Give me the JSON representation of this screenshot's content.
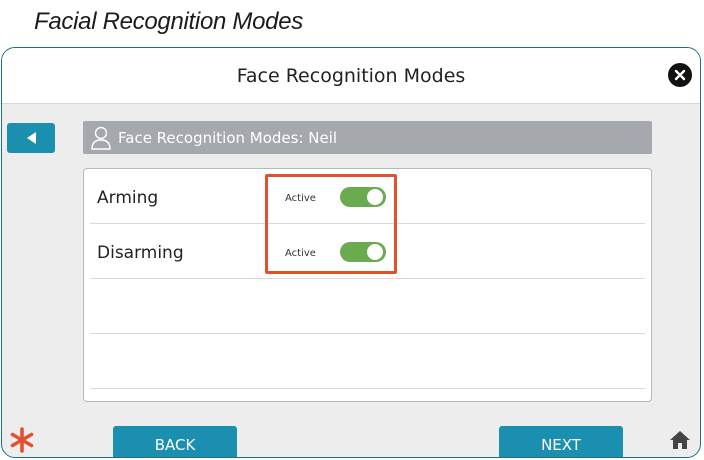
{
  "caption": "Facial Recognition Modes",
  "dialog": {
    "title": "Face Recognition Modes",
    "subheader": "Face Recognition Modes: Neil"
  },
  "modes": [
    {
      "label": "Arming",
      "status": "Active",
      "enabled": true
    },
    {
      "label": "Disarming",
      "status": "Active",
      "enabled": true
    }
  ],
  "footer": {
    "back_label": "BACK",
    "next_label": "NEXT"
  },
  "icons": {
    "close": "close-icon",
    "back": "back-arrow-icon",
    "user": "user-icon",
    "star": "asterisk-icon",
    "home": "home-icon"
  },
  "colors": {
    "accent": "#1b8fb0",
    "toggle_on": "#6aab4f",
    "highlight": "#e2512f",
    "subheader_bg": "#a5a9ad"
  }
}
